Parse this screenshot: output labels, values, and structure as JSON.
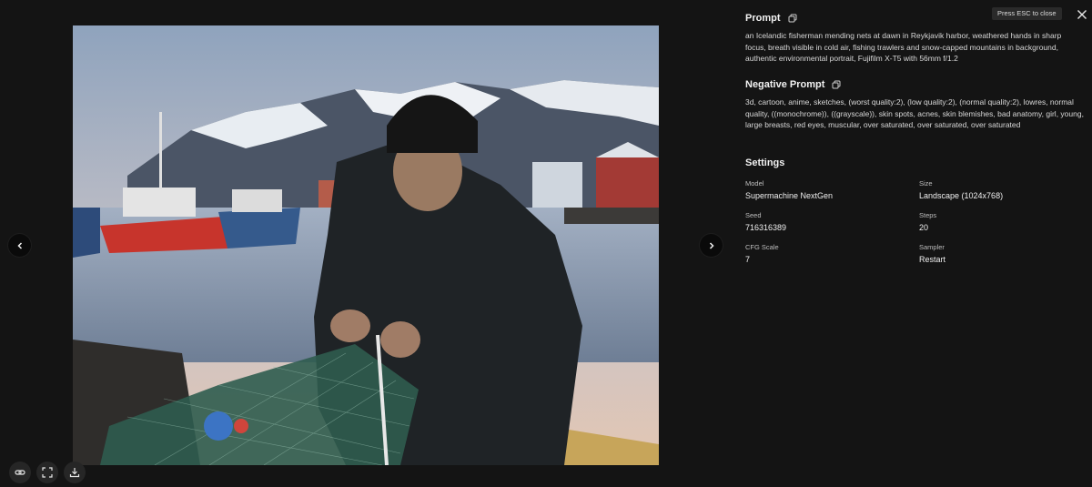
{
  "viewer": {
    "prev_icon": "chevron-left-icon",
    "next_icon": "chevron-right-icon",
    "tools": [
      {
        "icon": "link-icon"
      },
      {
        "icon": "expand-icon"
      },
      {
        "icon": "download-icon"
      }
    ]
  },
  "header": {
    "esc_hint": "Press ESC to close",
    "close_icon": "close-icon"
  },
  "prompt": {
    "title": "Prompt",
    "text": "an Icelandic fisherman mending nets at dawn in Reykjavik harbor, weathered hands in sharp focus, breath visible in cold air, fishing trawlers and snow-capped mountains in background, authentic environmental portrait, Fujifilm X-T5 with 56mm f/1.2"
  },
  "negative_prompt": {
    "title": "Negative Prompt",
    "text": "3d, cartoon, anime, sketches, (worst quality:2), (low quality:2), (normal quality:2), lowres, normal quality, ((monochrome)), ((grayscale)), skin spots, acnes, skin blemishes, bad anatomy, girl, young, large breasts, red eyes, muscular, over saturated, over saturated, over saturated"
  },
  "settings": {
    "title": "Settings",
    "model_label": "Model",
    "model": "Supermachine NextGen",
    "size_label": "Size",
    "size": "Landscape (1024x768)",
    "seed_label": "Seed",
    "seed": "716316389",
    "steps_label": "Steps",
    "steps": "20",
    "cfg_label": "CFG Scale",
    "cfg": "7",
    "sampler_label": "Sampler",
    "sampler": "Restart"
  },
  "colors": {
    "background": "#141414",
    "panel_text": "#d8d8d8",
    "button": "#0a0a0a"
  }
}
